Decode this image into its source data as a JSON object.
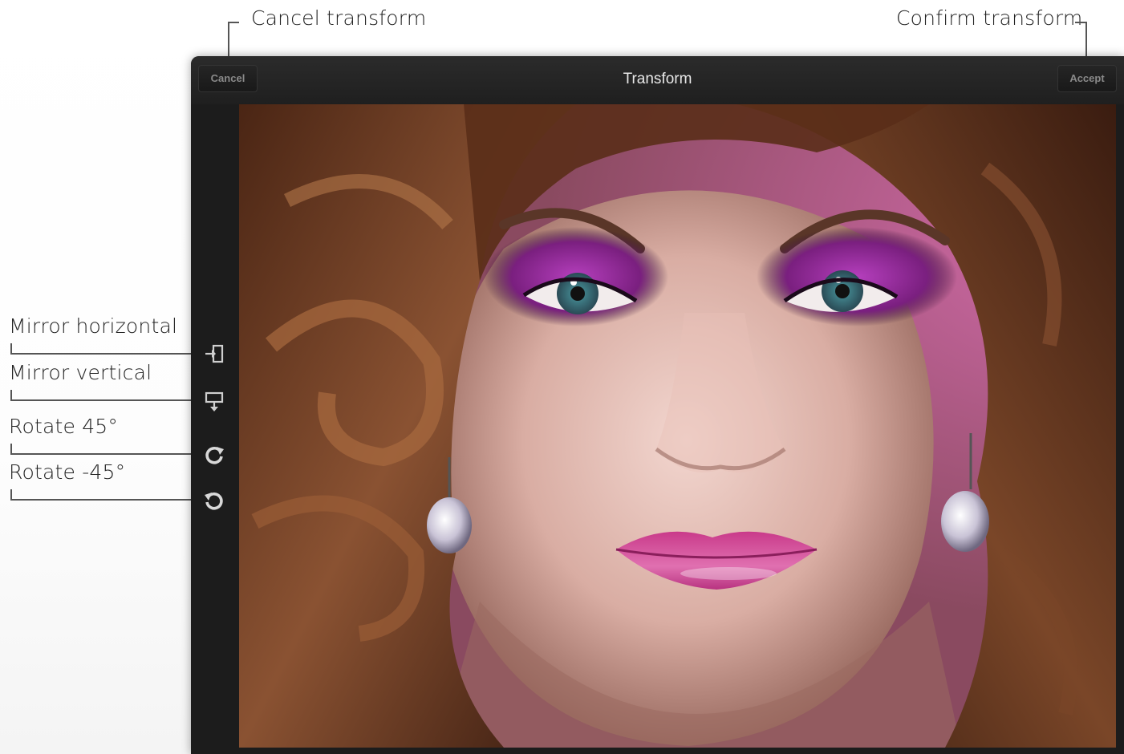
{
  "callouts": {
    "cancel": "Cancel transform",
    "confirm": "Confirm transform",
    "mirror_h": "Mirror horizontal",
    "mirror_v": "Mirror vertical",
    "rotate_cw": "Rotate 45°",
    "rotate_ccw": "Rotate -45°"
  },
  "toolbar": {
    "title": "Transform",
    "cancel_label": "Cancel",
    "accept_label": "Accept"
  },
  "tools": [
    {
      "name": "mirror-horizontal",
      "icon": "mirror-horizontal-icon"
    },
    {
      "name": "mirror-vertical",
      "icon": "mirror-vertical-icon"
    },
    {
      "name": "rotate-45",
      "icon": "rotate-cw-icon"
    },
    {
      "name": "rotate-minus-45",
      "icon": "rotate-ccw-icon"
    }
  ],
  "colors": {
    "window": "#1c1c1c",
    "button_text": "#8a8a8a",
    "title_text": "#e8e8e8",
    "eyeshadow": "#9b2fa0",
    "lips": "#d64a9a",
    "hair": "#6b3a22"
  }
}
